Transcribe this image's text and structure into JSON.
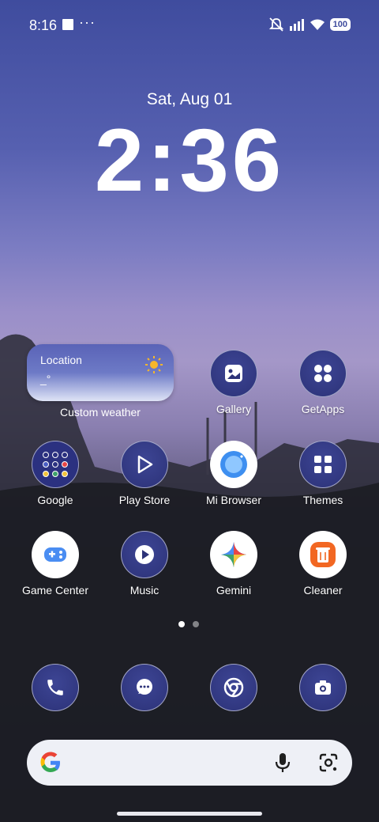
{
  "status_bar": {
    "time": "8:16",
    "more": "···",
    "battery": "100"
  },
  "lock": {
    "date": "Sat, Aug 01",
    "clock": "2:36"
  },
  "weather_widget": {
    "location": "Location",
    "value": "_°",
    "label": "Custom weather"
  },
  "apps": {
    "gallery": "Gallery",
    "getapps": "GetApps",
    "google": "Google",
    "play_store": "Play Store",
    "mi_browser": "Mi Browser",
    "themes": "Themes",
    "game_center": "Game Center",
    "music": "Music",
    "gemini": "Gemini",
    "cleaner": "Cleaner"
  },
  "pager": {
    "pages": 2,
    "current": 1
  },
  "colors": {
    "icon_bg": "#2c3278",
    "search_bg": "#eef0f6",
    "accent_orange": "#f26722"
  }
}
